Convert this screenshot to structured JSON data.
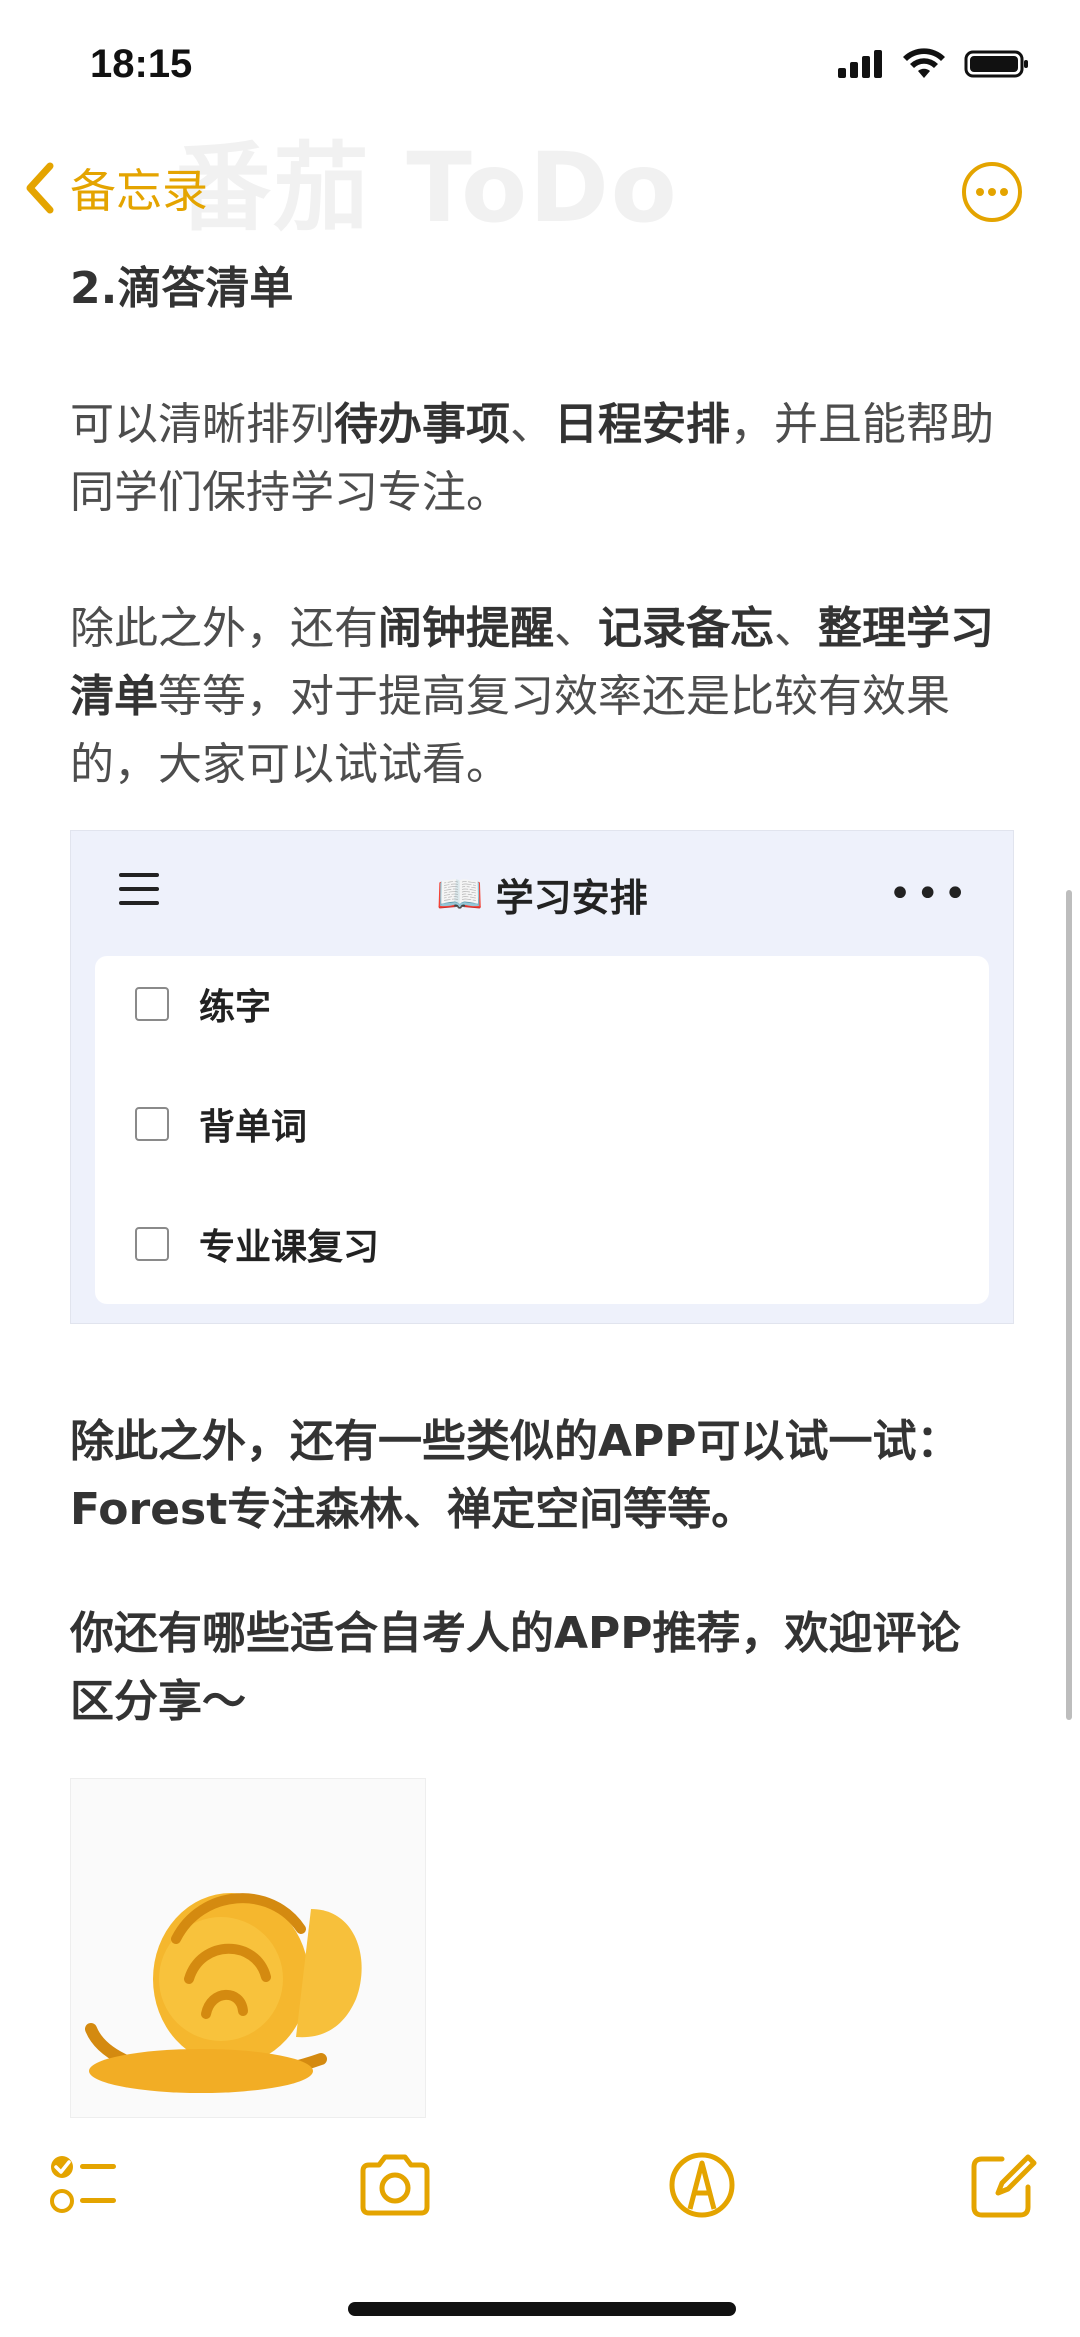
{
  "status_bar": {
    "time": "18:15"
  },
  "nav": {
    "back_label": "备忘录",
    "ghost_title": "番茄 ToDo"
  },
  "note": {
    "heading": "2.滴答清单",
    "para1": {
      "t1": "可以清晰排列",
      "b1": "待办事项",
      "t2": "、",
      "b2": "日程安排",
      "t3": "，并且能帮助同学们保持学习专注。"
    },
    "para2": {
      "t1": "除此之外，还有",
      "b1": "闹钟提醒",
      "t2": "、",
      "b2": "记录备忘",
      "t3": "、",
      "b3": "整理学习清单",
      "t4": "等等，对于提高复习效率还是比较有效果的，大家可以试试看。"
    },
    "para3": "除此之外，还有一些类似的APP可以试一试：Forest专注森林、禅定空间等等。",
    "para4": "你还有哪些适合自考人的APP推荐，欢迎评论区分享～"
  },
  "embed": {
    "title_icon": "📖",
    "title": "学习安排",
    "more": "•••",
    "tasks": [
      {
        "label": "练字",
        "checked": false
      },
      {
        "label": "背单词",
        "checked": false
      },
      {
        "label": "专业课复习",
        "checked": false
      }
    ]
  },
  "image": {
    "icon": "fist-emoji"
  },
  "toolbar": {
    "items": [
      "checklist-icon",
      "camera-icon",
      "markup-icon",
      "compose-icon"
    ]
  },
  "colors": {
    "accent": "#E4A400",
    "embed_bg": "#EEF1FB"
  }
}
